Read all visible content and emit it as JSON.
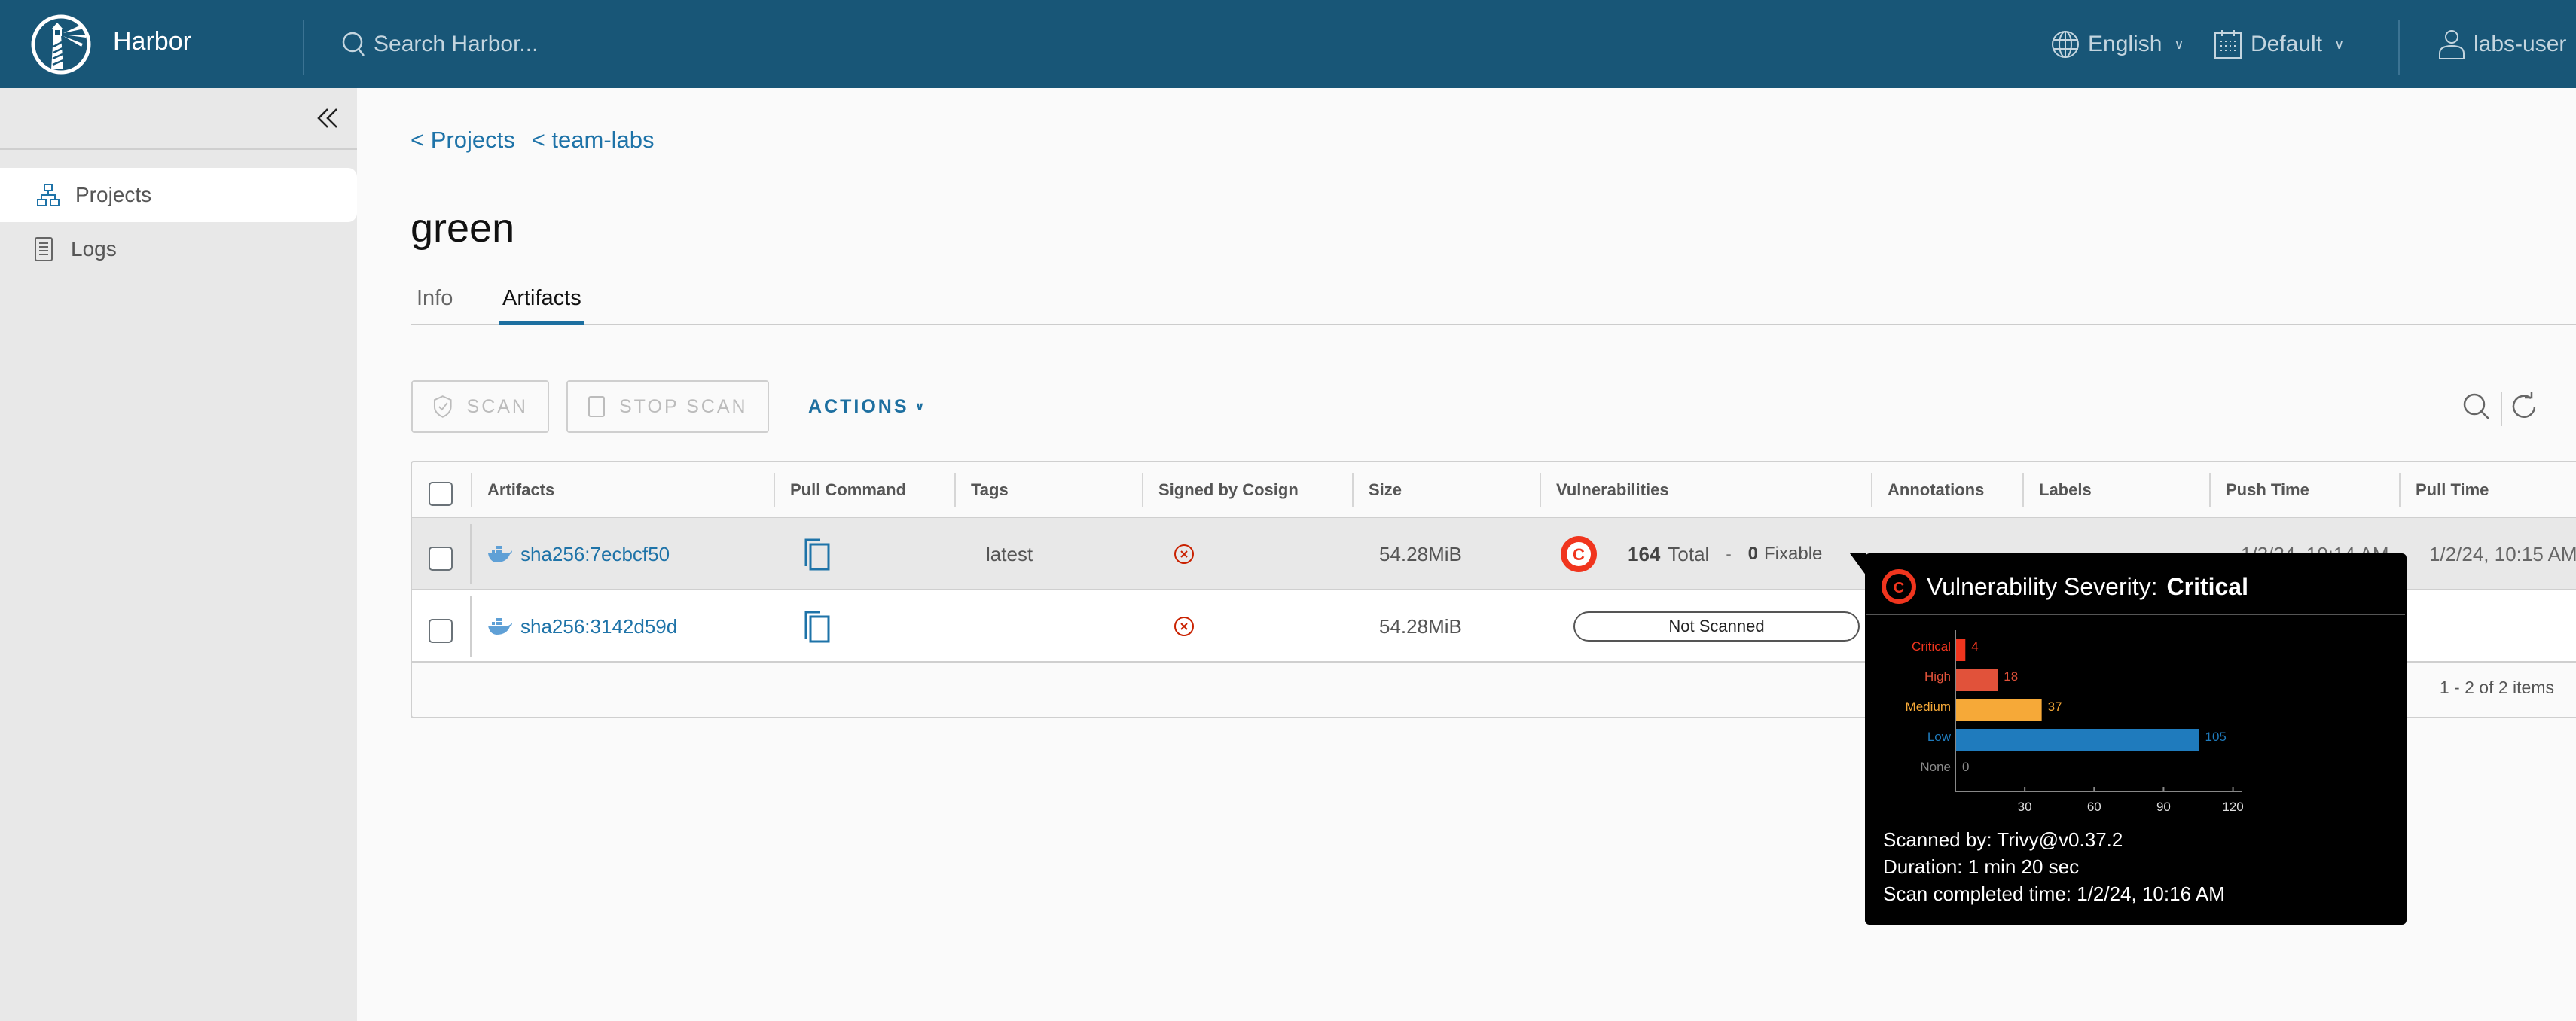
{
  "header": {
    "brand": "Harbor",
    "search_placeholder": "Search Harbor...",
    "language": "English",
    "datetime_format": "Default",
    "user": "labs-user"
  },
  "sidebar": {
    "items": [
      {
        "label": "Projects",
        "icon": "network-icon",
        "active": true
      },
      {
        "label": "Logs",
        "icon": "list-icon",
        "active": false
      }
    ]
  },
  "breadcrumb": [
    {
      "label": "< Projects"
    },
    {
      "label": "< team-labs"
    }
  ],
  "page": {
    "title": "green",
    "tabs": [
      {
        "label": "Info",
        "active": false
      },
      {
        "label": "Artifacts",
        "active": true
      }
    ]
  },
  "toolbar": {
    "scan_label": "SCAN",
    "stop_scan_label": "STOP SCAN",
    "actions_label": "ACTIONS"
  },
  "table": {
    "columns": [
      "Artifacts",
      "Pull Command",
      "Tags",
      "Signed by Cosign",
      "Size",
      "Vulnerabilities",
      "Annotations",
      "Labels",
      "Push Time",
      "Pull Time"
    ],
    "rows": [
      {
        "artifact": "sha256:7ecbcf50",
        "tags": "latest",
        "signed": "not-signed",
        "size": "54.28MiB",
        "vuln_severity_badge": "C",
        "vuln_total": "164",
        "vuln_total_label": "Total",
        "vuln_sep": "-",
        "vuln_fixable": "0",
        "vuln_fixable_label": "Fixable",
        "annotations": "",
        "labels": "",
        "push_time": "1/2/24, 10:14 AM",
        "pull_time": "1/2/24, 10:15 AM"
      },
      {
        "artifact": "sha256:3142d59d",
        "tags": "",
        "signed": "not-signed",
        "size": "54.28MiB",
        "vuln_status": "Not Scanned",
        "annotations": "",
        "labels": "",
        "push_time": "",
        "pull_time": ""
      }
    ],
    "pagination": "1 - 2 of 2 items"
  },
  "tooltip": {
    "badge": "C",
    "title_prefix": "Vulnerability Severity:",
    "title_severity": "Critical",
    "scanned_by": "Scanned by: Trivy@v0.37.2",
    "duration": "Duration: 1 min 20 sec",
    "completed": "Scan completed time: 1/2/24, 10:16 AM"
  },
  "colors": {
    "header_bg": "#185677",
    "accent": "#1e73a8",
    "critical": "#f0351e",
    "high": "#e1523a",
    "medium": "#f6a938",
    "low": "#1f7bbd",
    "none": "#8a8a8a"
  },
  "chart_data": {
    "type": "bar",
    "orientation": "horizontal",
    "categories": [
      "Critical",
      "High",
      "Medium",
      "Low",
      "None"
    ],
    "values": [
      4,
      18,
      37,
      105,
      0
    ],
    "colors": [
      "#f0351e",
      "#e1523a",
      "#f6a938",
      "#1f7bbd",
      "#8a8a8a"
    ],
    "xticks": [
      30,
      60,
      90,
      120
    ],
    "xlim": [
      0,
      140
    ],
    "title": "",
    "xlabel": "",
    "ylabel": "",
    "grid": false
  }
}
